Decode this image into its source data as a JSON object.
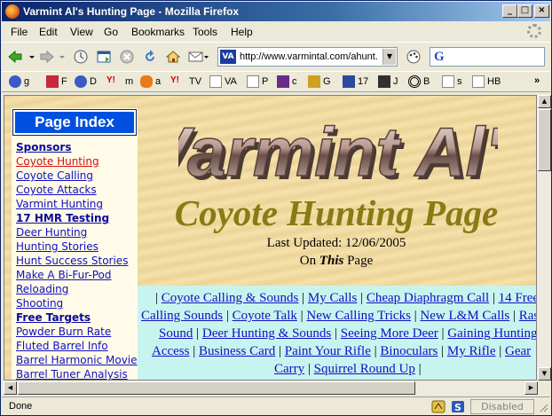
{
  "window": {
    "title": "Varmint Al's Hunting Page - Mozilla Firefox"
  },
  "menu": [
    "File",
    "Edit",
    "View",
    "Go",
    "Bookmarks",
    "Tools",
    "Help"
  ],
  "nav": {
    "url": "http://www.varmintal.com/ahunt.",
    "site_icon_text": "VA",
    "search_icon_text": "G"
  },
  "bookmarks": [
    "g",
    "F",
    "D",
    "m",
    "a",
    "TV",
    "VA",
    "P",
    "c",
    "G",
    "17",
    "J",
    "B",
    "s",
    "HB"
  ],
  "status": {
    "text": "Done",
    "disabled_label": "Disabled"
  },
  "page": {
    "sidebar_title": "Page Index",
    "sidebar_items": [
      {
        "label": "Sponsors",
        "style": "bold"
      },
      {
        "label": "Coyote Hunting",
        "style": "visited"
      },
      {
        "label": "Coyote Calling",
        "style": ""
      },
      {
        "label": "Coyote Attacks",
        "style": ""
      },
      {
        "label": "Varmint Hunting",
        "style": ""
      },
      {
        "label": "17 HMR Testing",
        "style": "bold"
      },
      {
        "label": "Deer Hunting",
        "style": ""
      },
      {
        "label": "Hunting Stories",
        "style": ""
      },
      {
        "label": "Hunt Success Stories",
        "style": ""
      },
      {
        "label": "Make A Bi-Fur-Pod",
        "style": ""
      },
      {
        "label": "Reloading",
        "style": ""
      },
      {
        "label": "Shooting",
        "style": ""
      },
      {
        "label": "Free Targets",
        "style": "bold"
      },
      {
        "label": "Powder Burn Rate",
        "style": ""
      },
      {
        "label": "Fluted Barrel Info",
        "style": ""
      },
      {
        "label": "Barrel Harmonic Movie",
        "style": ""
      },
      {
        "label": "Barrel Tuner Analysis",
        "style": ""
      }
    ],
    "logo_text": "Varmint Al's",
    "title": "Coyote Hunting Page",
    "last_updated": "Last Updated: 12/06/2005",
    "on_prefix": "On ",
    "on_emph": "This",
    "on_suffix": " Page",
    "link_lines": [
      {
        "offset": 20,
        "prefix": "| ",
        "links": [
          "Coyote Calling & Sounds",
          "My Calls",
          "Cheap Diaphragm Call",
          "14 Free"
        ]
      },
      {
        "offset": 4,
        "prefix": "",
        "links": [
          "Calling Sounds",
          "Coyote Talk",
          "New Calling Tricks",
          "New L&M Calls",
          "Ras"
        ]
      },
      {
        "offset": 24,
        "prefix": "",
        "links": [
          "Sound",
          "Deer Hunting & Sounds",
          " Seeing More Deer",
          "Gaining Hunting"
        ]
      },
      {
        "offset": 16,
        "prefix": "",
        "links": [
          "Access",
          "Business Card",
          " Paint Your Rifle",
          "Binoculars",
          "My Rifle",
          "Gear"
        ]
      },
      {
        "offset": 154,
        "prefix": "",
        "links": [
          "Carry",
          "Squirrel Round Up"
        ],
        "suffix": " |"
      }
    ]
  }
}
